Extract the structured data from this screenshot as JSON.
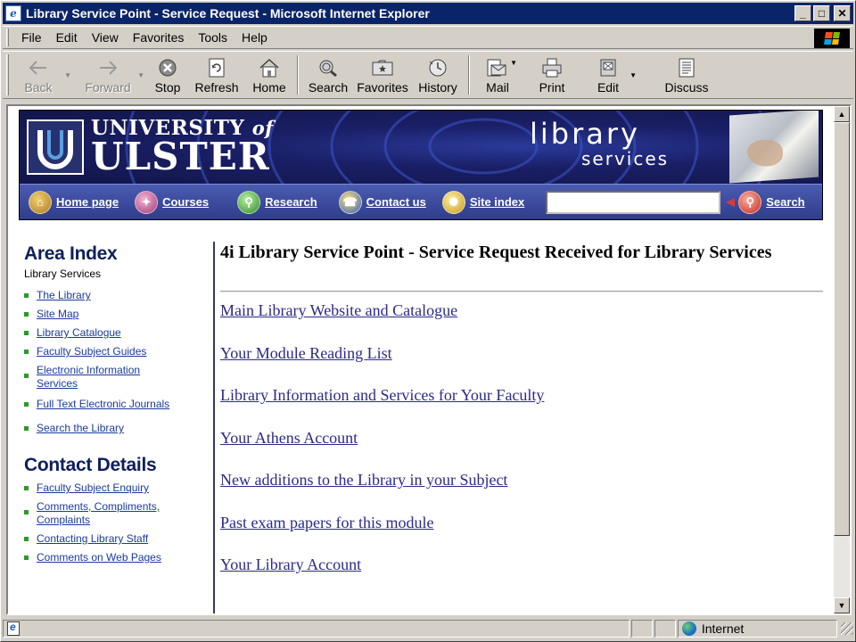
{
  "window": {
    "title": "Library Service Point - Service Request - Microsoft Internet Explorer",
    "minimize": "_",
    "maximize": "□",
    "close": "✕"
  },
  "menu": [
    "File",
    "Edit",
    "View",
    "Favorites",
    "Tools",
    "Help"
  ],
  "toolbar": {
    "back": "Back",
    "forward": "Forward",
    "stop": "Stop",
    "refresh": "Refresh",
    "home": "Home",
    "search": "Search",
    "favorites": "Favorites",
    "history": "History",
    "mail": "Mail",
    "print": "Print",
    "edit": "Edit",
    "discuss": "Discuss"
  },
  "banner": {
    "univ_line": "UNIVERSITY",
    "of": "of",
    "ulster": "LSTER",
    "ulster_initial": "U",
    "library": "library",
    "services": "services"
  },
  "nav": {
    "items": [
      "Home page",
      "Courses",
      "Research",
      "Contact us",
      "Site index"
    ],
    "search": "Search"
  },
  "sidebar": {
    "area_title": "Area Index",
    "area_sub": "Library Services",
    "area_links": [
      "The Library",
      "Site Map",
      "Library Catalogue",
      "Faculty Subject Guides",
      "Electronic Information Services",
      "Full Text Electronic Journals",
      "Search the Library"
    ],
    "contact_title": "Contact Details",
    "contact_links": [
      "Faculty Subject Enquiry",
      "Comments, Compliments, Complaints",
      "Contacting Library Staff",
      "Comments on Web Pages"
    ]
  },
  "main": {
    "title": "4i Library Service Point - Service Request Received for Library Services",
    "links": [
      "Main Library Website and Catalogue",
      "Your Module Reading List",
      "Library Information and Services for Your Faculty",
      "Your Athens Account",
      "New additions to the Library in your Subject",
      "Past exam papers for this module",
      "Your Library Account"
    ]
  },
  "status": {
    "zone": "Internet"
  },
  "colors": {
    "titlebar": "#0a246a",
    "banner": "#1b1d5c",
    "navbar": "#3a4a9e",
    "link": "#2a2a8a",
    "bullet": "#2a9a2a"
  }
}
